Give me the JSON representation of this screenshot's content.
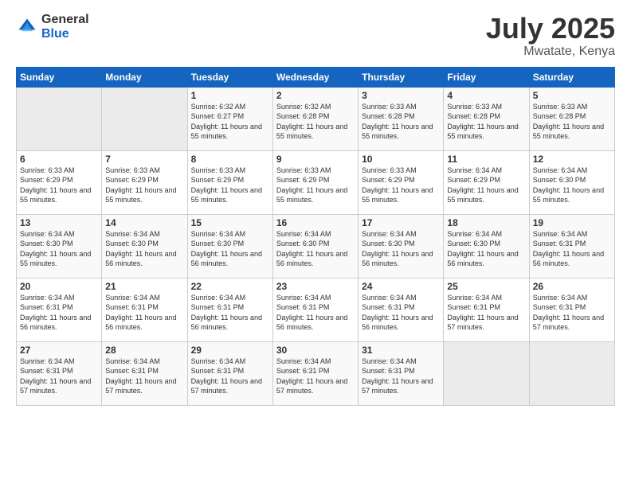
{
  "header": {
    "logo_general": "General",
    "logo_blue": "Blue",
    "month": "July 2025",
    "location": "Mwatate, Kenya"
  },
  "weekdays": [
    "Sunday",
    "Monday",
    "Tuesday",
    "Wednesday",
    "Thursday",
    "Friday",
    "Saturday"
  ],
  "weeks": [
    [
      {
        "day": "",
        "info": ""
      },
      {
        "day": "",
        "info": ""
      },
      {
        "day": "1",
        "info": "Sunrise: 6:32 AM\nSunset: 6:27 PM\nDaylight: 11 hours and 55 minutes."
      },
      {
        "day": "2",
        "info": "Sunrise: 6:32 AM\nSunset: 6:28 PM\nDaylight: 11 hours and 55 minutes."
      },
      {
        "day": "3",
        "info": "Sunrise: 6:33 AM\nSunset: 6:28 PM\nDaylight: 11 hours and 55 minutes."
      },
      {
        "day": "4",
        "info": "Sunrise: 6:33 AM\nSunset: 6:28 PM\nDaylight: 11 hours and 55 minutes."
      },
      {
        "day": "5",
        "info": "Sunrise: 6:33 AM\nSunset: 6:28 PM\nDaylight: 11 hours and 55 minutes."
      }
    ],
    [
      {
        "day": "6",
        "info": "Sunrise: 6:33 AM\nSunset: 6:29 PM\nDaylight: 11 hours and 55 minutes."
      },
      {
        "day": "7",
        "info": "Sunrise: 6:33 AM\nSunset: 6:29 PM\nDaylight: 11 hours and 55 minutes."
      },
      {
        "day": "8",
        "info": "Sunrise: 6:33 AM\nSunset: 6:29 PM\nDaylight: 11 hours and 55 minutes."
      },
      {
        "day": "9",
        "info": "Sunrise: 6:33 AM\nSunset: 6:29 PM\nDaylight: 11 hours and 55 minutes."
      },
      {
        "day": "10",
        "info": "Sunrise: 6:33 AM\nSunset: 6:29 PM\nDaylight: 11 hours and 55 minutes."
      },
      {
        "day": "11",
        "info": "Sunrise: 6:34 AM\nSunset: 6:29 PM\nDaylight: 11 hours and 55 minutes."
      },
      {
        "day": "12",
        "info": "Sunrise: 6:34 AM\nSunset: 6:30 PM\nDaylight: 11 hours and 55 minutes."
      }
    ],
    [
      {
        "day": "13",
        "info": "Sunrise: 6:34 AM\nSunset: 6:30 PM\nDaylight: 11 hours and 55 minutes."
      },
      {
        "day": "14",
        "info": "Sunrise: 6:34 AM\nSunset: 6:30 PM\nDaylight: 11 hours and 56 minutes."
      },
      {
        "day": "15",
        "info": "Sunrise: 6:34 AM\nSunset: 6:30 PM\nDaylight: 11 hours and 56 minutes."
      },
      {
        "day": "16",
        "info": "Sunrise: 6:34 AM\nSunset: 6:30 PM\nDaylight: 11 hours and 56 minutes."
      },
      {
        "day": "17",
        "info": "Sunrise: 6:34 AM\nSunset: 6:30 PM\nDaylight: 11 hours and 56 minutes."
      },
      {
        "day": "18",
        "info": "Sunrise: 6:34 AM\nSunset: 6:30 PM\nDaylight: 11 hours and 56 minutes."
      },
      {
        "day": "19",
        "info": "Sunrise: 6:34 AM\nSunset: 6:31 PM\nDaylight: 11 hours and 56 minutes."
      }
    ],
    [
      {
        "day": "20",
        "info": "Sunrise: 6:34 AM\nSunset: 6:31 PM\nDaylight: 11 hours and 56 minutes."
      },
      {
        "day": "21",
        "info": "Sunrise: 6:34 AM\nSunset: 6:31 PM\nDaylight: 11 hours and 56 minutes."
      },
      {
        "day": "22",
        "info": "Sunrise: 6:34 AM\nSunset: 6:31 PM\nDaylight: 11 hours and 56 minutes."
      },
      {
        "day": "23",
        "info": "Sunrise: 6:34 AM\nSunset: 6:31 PM\nDaylight: 11 hours and 56 minutes."
      },
      {
        "day": "24",
        "info": "Sunrise: 6:34 AM\nSunset: 6:31 PM\nDaylight: 11 hours and 56 minutes."
      },
      {
        "day": "25",
        "info": "Sunrise: 6:34 AM\nSunset: 6:31 PM\nDaylight: 11 hours and 57 minutes."
      },
      {
        "day": "26",
        "info": "Sunrise: 6:34 AM\nSunset: 6:31 PM\nDaylight: 11 hours and 57 minutes."
      }
    ],
    [
      {
        "day": "27",
        "info": "Sunrise: 6:34 AM\nSunset: 6:31 PM\nDaylight: 11 hours and 57 minutes."
      },
      {
        "day": "28",
        "info": "Sunrise: 6:34 AM\nSunset: 6:31 PM\nDaylight: 11 hours and 57 minutes."
      },
      {
        "day": "29",
        "info": "Sunrise: 6:34 AM\nSunset: 6:31 PM\nDaylight: 11 hours and 57 minutes."
      },
      {
        "day": "30",
        "info": "Sunrise: 6:34 AM\nSunset: 6:31 PM\nDaylight: 11 hours and 57 minutes."
      },
      {
        "day": "31",
        "info": "Sunrise: 6:34 AM\nSunset: 6:31 PM\nDaylight: 11 hours and 57 minutes."
      },
      {
        "day": "",
        "info": ""
      },
      {
        "day": "",
        "info": ""
      }
    ]
  ]
}
